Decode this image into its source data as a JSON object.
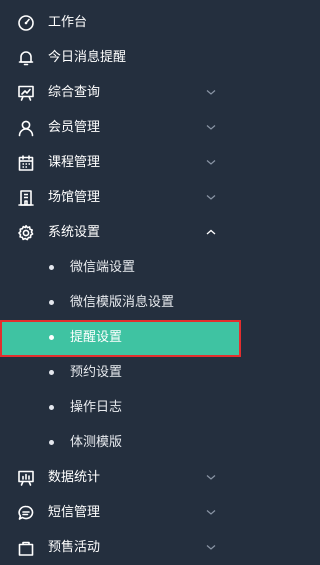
{
  "menu": {
    "items": [
      {
        "label": "工作台",
        "icon": "dashboard-icon",
        "has_chevron": false
      },
      {
        "label": "今日消息提醒",
        "icon": "bell-icon",
        "has_chevron": false
      },
      {
        "label": "综合查询",
        "icon": "chart-board-icon",
        "has_chevron": true
      },
      {
        "label": "会员管理",
        "icon": "user-icon",
        "has_chevron": true
      },
      {
        "label": "课程管理",
        "icon": "calendar-icon",
        "has_chevron": true
      },
      {
        "label": "场馆管理",
        "icon": "building-icon",
        "has_chevron": true
      },
      {
        "label": "系统设置",
        "icon": "gear-icon",
        "has_chevron": true,
        "expanded": true
      }
    ],
    "submenu": [
      {
        "label": "微信端设置"
      },
      {
        "label": "微信模版消息设置"
      },
      {
        "label": "提醒设置",
        "active": true
      },
      {
        "label": "预约设置"
      },
      {
        "label": "操作日志"
      },
      {
        "label": "体测模版"
      }
    ],
    "bottom_items": [
      {
        "label": "数据统计",
        "icon": "bar-chart-board-icon",
        "has_chevron": true
      },
      {
        "label": "短信管理",
        "icon": "chat-icon",
        "has_chevron": true
      },
      {
        "label": "预售活动",
        "icon": "bag-icon",
        "has_chevron": true
      }
    ]
  },
  "colors": {
    "background": "#242f3e",
    "active_background": "#3fc3a2",
    "active_outline": "#e42e2e",
    "text": "#ffffff"
  }
}
